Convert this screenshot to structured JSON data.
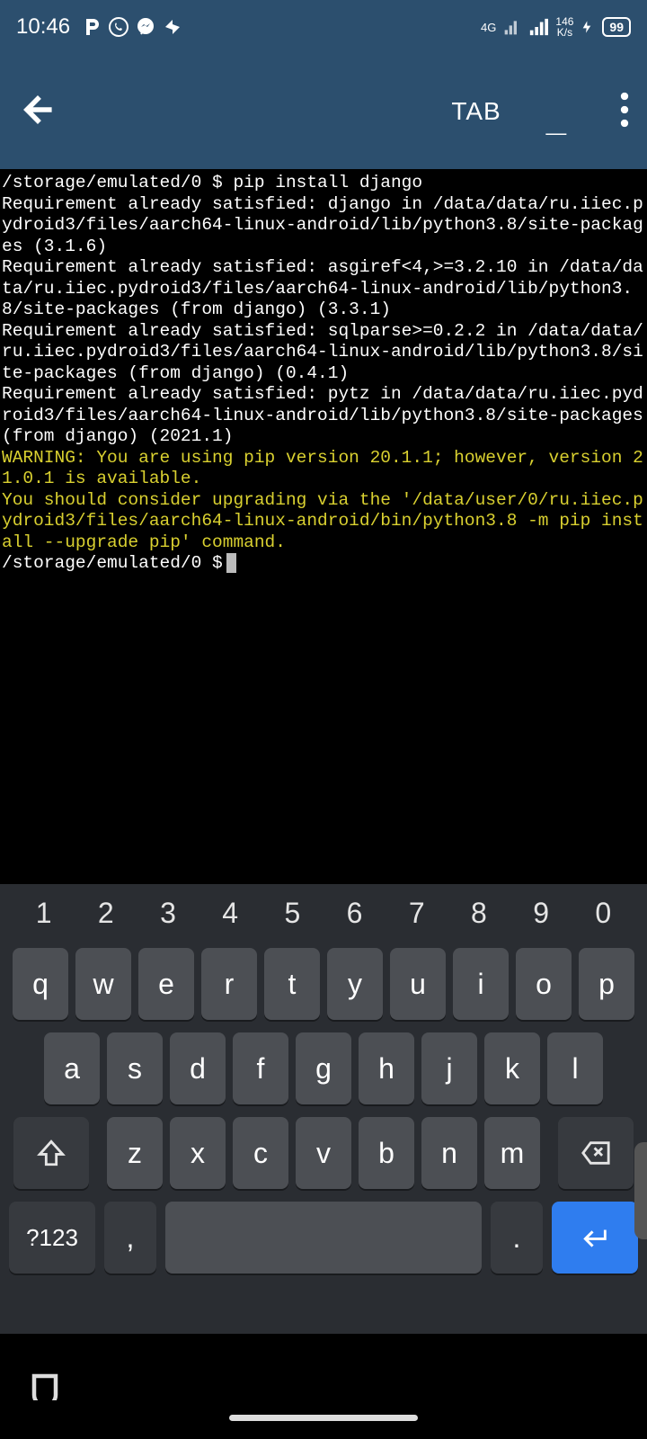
{
  "status": {
    "time": "10:46",
    "network_label": "4G",
    "speed_value": "146",
    "speed_unit": "K/s",
    "battery": "99"
  },
  "toolbar": {
    "tab_label": "TAB",
    "underscore": "_"
  },
  "terminal": {
    "line1": "/storage/emulated/0 $ pip install django",
    "line2": "Requirement already satisfied: django in /data/data/ru.iiec.pydroid3/files/aarch64-linux-android/lib/python3.8/site-packages (3.1.6)",
    "line3": "Requirement already satisfied: asgiref<4,>=3.2.10 in /data/data/ru.iiec.pydroid3/files/aarch64-linux-android/lib/python3.8/site-packages (from django) (3.3.1)",
    "line4": "Requirement already satisfied: sqlparse>=0.2.2 in /data/data/ru.iiec.pydroid3/files/aarch64-linux-android/lib/python3.8/site-packages (from django) (0.4.1)",
    "line5": "Requirement already satisfied: pytz in /data/data/ru.iiec.pydroid3/files/aarch64-linux-android/lib/python3.8/site-packages (from django) (2021.1)",
    "warn1": "WARNING: You are using pip version 20.1.1; however, version 21.0.1 is available.",
    "warn2": "You should consider upgrading via the '/data/user/0/ru.iiec.pydroid3/files/aarch64-linux-android/bin/python3.8 -m pip install --upgrade pip' command.",
    "prompt": "/storage/emulated/0 $"
  },
  "keys": {
    "nums": [
      "1",
      "2",
      "3",
      "4",
      "5",
      "6",
      "7",
      "8",
      "9",
      "0"
    ],
    "r2": [
      "q",
      "w",
      "e",
      "r",
      "t",
      "y",
      "u",
      "i",
      "o",
      "p"
    ],
    "r3": [
      "a",
      "s",
      "d",
      "f",
      "g",
      "h",
      "j",
      "k",
      "l"
    ],
    "r4": [
      "z",
      "x",
      "c",
      "v",
      "b",
      "n",
      "m"
    ],
    "sym": "?123",
    "comma": ",",
    "period": "."
  }
}
